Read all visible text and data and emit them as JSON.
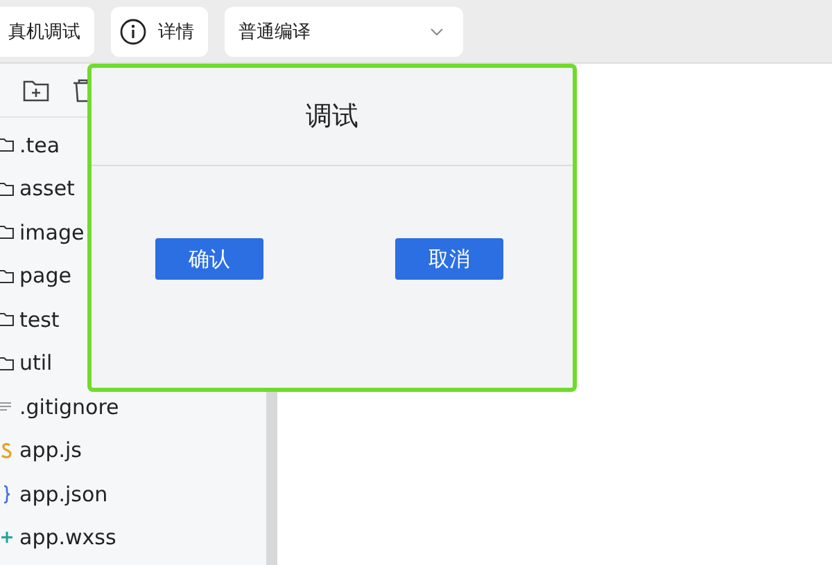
{
  "toolbar": {
    "buttons": [
      {
        "label": "真机调试",
        "kind": "plain"
      },
      {
        "label": "详情",
        "kind": "info"
      }
    ],
    "compile_select": {
      "value": "普通编译"
    }
  },
  "file_tree": {
    "items": [
      {
        "name": ".tea",
        "kind": "folder"
      },
      {
        "name": "asset",
        "kind": "folder"
      },
      {
        "name": "image",
        "kind": "folder"
      },
      {
        "name": "page",
        "kind": "folder"
      },
      {
        "name": "test",
        "kind": "folder"
      },
      {
        "name": "util",
        "kind": "folder"
      },
      {
        "name": ".gitignore",
        "kind": "text"
      },
      {
        "name": "app.js",
        "kind": "js"
      },
      {
        "name": "app.json",
        "kind": "json"
      },
      {
        "name": "app.wxss",
        "kind": "wxss"
      }
    ]
  },
  "dialog": {
    "title": "调试",
    "buttons": [
      "确认",
      "取消"
    ]
  }
}
